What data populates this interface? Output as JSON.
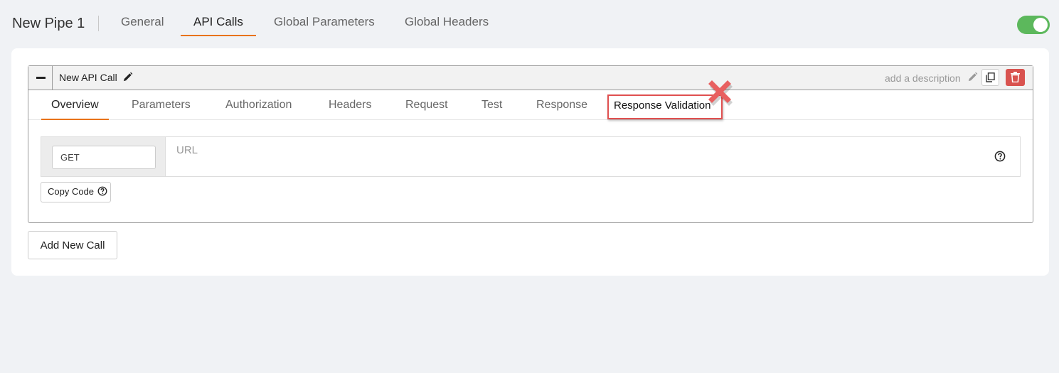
{
  "pipe": {
    "title": "New Pipe 1"
  },
  "top_tabs": [
    {
      "label": "General"
    },
    {
      "label": "API Calls"
    },
    {
      "label": "Global Parameters"
    },
    {
      "label": "Global Headers"
    }
  ],
  "toggle": {
    "state": "on",
    "color": "#5cb85c"
  },
  "api_call": {
    "name": "New API Call",
    "description_placeholder": "add a description",
    "tabs": [
      {
        "label": "Overview"
      },
      {
        "label": "Parameters"
      },
      {
        "label": "Authorization"
      },
      {
        "label": "Headers"
      },
      {
        "label": "Request"
      },
      {
        "label": "Test"
      },
      {
        "label": "Response"
      },
      {
        "label": "Response Validation"
      }
    ],
    "method_value": "GET",
    "url_placeholder": "URL",
    "copy_code_label": "Copy Code"
  },
  "add_new_call_label": "Add New Call",
  "colors": {
    "accent": "#e8731a",
    "delete": "#d9534f",
    "highlight": "#e05050"
  }
}
